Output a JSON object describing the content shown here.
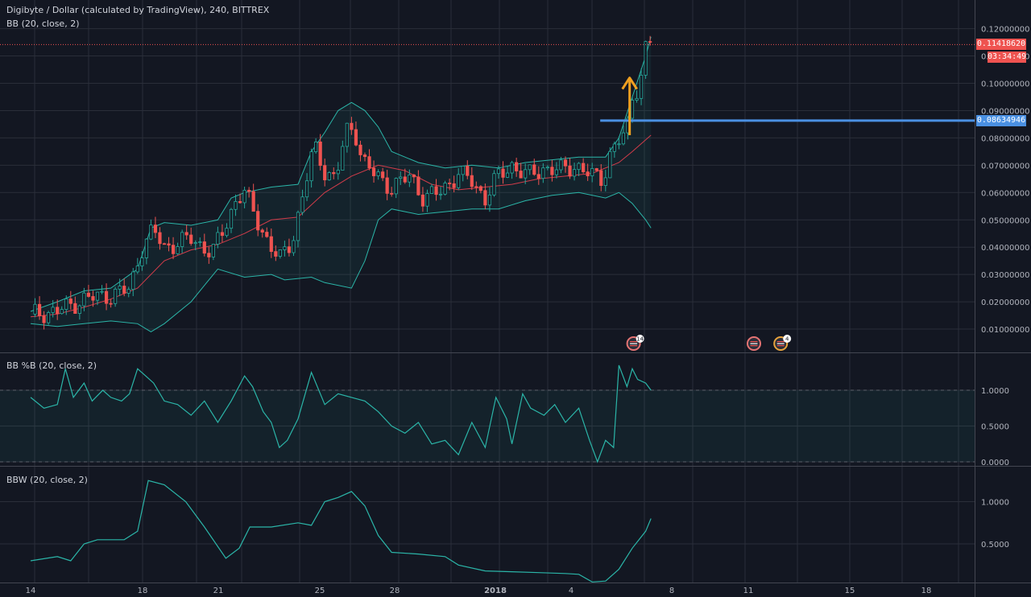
{
  "header": {
    "title": "Digibyte / Dollar (calculated by TradingView), 240, BITTREX",
    "bb_label": "BB (20, close, 2)",
    "pctb_label": "BB %B (20, close, 2)",
    "bbw_label": "BBW (20, close, 2)"
  },
  "tags": {
    "last_price": "0.11418620",
    "countdown": "03:34:49",
    "level_price": "0.08634946",
    "hidden_prefix": "0."
  },
  "events": [
    {
      "date_index": 23.0,
      "badge": "14"
    },
    {
      "date_index": 27.5,
      "badge": ""
    },
    {
      "date_index": 28.5,
      "badge": "4"
    }
  ],
  "colors": {
    "background": "#131722",
    "grid": "#2a2e39",
    "up": "#26a69a",
    "down": "#ef5350",
    "band": "#2bb5a8",
    "basis": "#d23c4a",
    "level": "#4a90e2",
    "arrow": "#f0a020",
    "price_line": "#ef5350"
  },
  "chart_data": [
    {
      "type": "candlestick",
      "title": "Digibyte / Dollar (calculated by TradingView), 240, BITTREX",
      "x_ticks": [
        "14",
        "18",
        "21",
        "25",
        "28",
        "2018",
        "4",
        "8",
        "11",
        "15",
        "18"
      ],
      "y_ticks": [
        "0.12000000",
        "0.11000000",
        "0.10000000",
        "0.09000000",
        "0.08000000",
        "0.07000000",
        "0.06000000",
        "0.05000000",
        "0.04000000",
        "0.03000000",
        "0.02000000",
        "0.01000000"
      ],
      "ylim": [
        0.002,
        0.125
      ],
      "horizontal_level": 0.08634946,
      "last_price": 0.1141862,
      "arrow": {
        "date_index": 22.4,
        "from": 0.081,
        "to": 0.102
      },
      "close_series": [
        {
          "d": 0.0,
          "v": 0.0155
        },
        {
          "d": 1.0,
          "v": 0.0165
        },
        {
          "d": 2.0,
          "v": 0.021
        },
        {
          "d": 3.0,
          "v": 0.0225
        },
        {
          "d": 3.7,
          "v": 0.0245
        },
        {
          "d": 4.2,
          "v": 0.041
        },
        {
          "d": 4.6,
          "v": 0.046
        },
        {
          "d": 5.0,
          "v": 0.04
        },
        {
          "d": 6.0,
          "v": 0.043
        },
        {
          "d": 6.8,
          "v": 0.038
        },
        {
          "d": 7.3,
          "v": 0.048
        },
        {
          "d": 7.7,
          "v": 0.058
        },
        {
          "d": 8.0,
          "v": 0.06
        },
        {
          "d": 8.6,
          "v": 0.047
        },
        {
          "d": 9.3,
          "v": 0.035
        },
        {
          "d": 9.8,
          "v": 0.043
        },
        {
          "d": 10.2,
          "v": 0.06
        },
        {
          "d": 10.6,
          "v": 0.077
        },
        {
          "d": 11.0,
          "v": 0.068
        },
        {
          "d": 11.4,
          "v": 0.065
        },
        {
          "d": 11.8,
          "v": 0.082
        },
        {
          "d": 12.1,
          "v": 0.084
        },
        {
          "d": 12.4,
          "v": 0.072
        },
        {
          "d": 12.9,
          "v": 0.066
        },
        {
          "d": 13.5,
          "v": 0.062
        },
        {
          "d": 14.2,
          "v": 0.066
        },
        {
          "d": 14.7,
          "v": 0.058
        },
        {
          "d": 15.3,
          "v": 0.06
        },
        {
          "d": 16.0,
          "v": 0.067
        },
        {
          "d": 16.5,
          "v": 0.064
        },
        {
          "d": 17.0,
          "v": 0.058
        },
        {
          "d": 17.4,
          "v": 0.065
        },
        {
          "d": 18.0,
          "v": 0.07
        },
        {
          "d": 18.6,
          "v": 0.066
        },
        {
          "d": 19.2,
          "v": 0.069
        },
        {
          "d": 19.8,
          "v": 0.068
        },
        {
          "d": 20.4,
          "v": 0.07
        },
        {
          "d": 21.0,
          "v": 0.066
        },
        {
          "d": 21.4,
          "v": 0.065
        },
        {
          "d": 21.7,
          "v": 0.075
        },
        {
          "d": 22.0,
          "v": 0.079
        },
        {
          "d": 22.3,
          "v": 0.082
        },
        {
          "d": 22.5,
          "v": 0.095
        },
        {
          "d": 22.7,
          "v": 0.099
        },
        {
          "d": 22.9,
          "v": 0.105
        },
        {
          "d": 23.05,
          "v": 0.117
        },
        {
          "d": 23.25,
          "v": 0.1142
        }
      ],
      "bb_upper": [
        {
          "d": 0.0,
          "v": 0.0165
        },
        {
          "d": 1.0,
          "v": 0.02
        },
        {
          "d": 2.0,
          "v": 0.024
        },
        {
          "d": 3.0,
          "v": 0.025
        },
        {
          "d": 4.0,
          "v": 0.032
        },
        {
          "d": 4.5,
          "v": 0.047
        },
        {
          "d": 5.0,
          "v": 0.049
        },
        {
          "d": 6.0,
          "v": 0.048
        },
        {
          "d": 7.0,
          "v": 0.05
        },
        {
          "d": 7.5,
          "v": 0.058
        },
        {
          "d": 8.0,
          "v": 0.06
        },
        {
          "d": 9.0,
          "v": 0.062
        },
        {
          "d": 10.0,
          "v": 0.063
        },
        {
          "d": 10.5,
          "v": 0.075
        },
        {
          "d": 11.0,
          "v": 0.082
        },
        {
          "d": 11.5,
          "v": 0.09
        },
        {
          "d": 12.0,
          "v": 0.093
        },
        {
          "d": 12.5,
          "v": 0.09
        },
        {
          "d": 13.0,
          "v": 0.084
        },
        {
          "d": 13.5,
          "v": 0.075
        },
        {
          "d": 14.5,
          "v": 0.071
        },
        {
          "d": 15.5,
          "v": 0.069
        },
        {
          "d": 16.5,
          "v": 0.07
        },
        {
          "d": 17.5,
          "v": 0.069
        },
        {
          "d": 18.5,
          "v": 0.071
        },
        {
          "d": 19.5,
          "v": 0.072
        },
        {
          "d": 20.5,
          "v": 0.073
        },
        {
          "d": 21.5,
          "v": 0.073
        },
        {
          "d": 22.0,
          "v": 0.08
        },
        {
          "d": 22.5,
          "v": 0.095
        },
        {
          "d": 23.0,
          "v": 0.11
        },
        {
          "d": 23.2,
          "v": 0.117
        }
      ],
      "bb_basis": [
        {
          "d": 0.0,
          "v": 0.0145
        },
        {
          "d": 1.0,
          "v": 0.0155
        },
        {
          "d": 2.0,
          "v": 0.018
        },
        {
          "d": 3.0,
          "v": 0.021
        },
        {
          "d": 4.0,
          "v": 0.025
        },
        {
          "d": 5.0,
          "v": 0.035
        },
        {
          "d": 6.0,
          "v": 0.039
        },
        {
          "d": 7.0,
          "v": 0.041
        },
        {
          "d": 8.0,
          "v": 0.045
        },
        {
          "d": 9.0,
          "v": 0.05
        },
        {
          "d": 10.0,
          "v": 0.051
        },
        {
          "d": 11.0,
          "v": 0.06
        },
        {
          "d": 12.0,
          "v": 0.066
        },
        {
          "d": 13.0,
          "v": 0.07
        },
        {
          "d": 14.0,
          "v": 0.068
        },
        {
          "d": 15.0,
          "v": 0.063
        },
        {
          "d": 16.0,
          "v": 0.061
        },
        {
          "d": 17.0,
          "v": 0.062
        },
        {
          "d": 18.0,
          "v": 0.063
        },
        {
          "d": 19.0,
          "v": 0.065
        },
        {
          "d": 20.0,
          "v": 0.066
        },
        {
          "d": 21.0,
          "v": 0.067
        },
        {
          "d": 22.0,
          "v": 0.071
        },
        {
          "d": 22.5,
          "v": 0.075
        },
        {
          "d": 23.2,
          "v": 0.081
        }
      ],
      "bb_lower": [
        {
          "d": 0.0,
          "v": 0.012
        },
        {
          "d": 1.0,
          "v": 0.011
        },
        {
          "d": 2.0,
          "v": 0.012
        },
        {
          "d": 3.0,
          "v": 0.013
        },
        {
          "d": 4.0,
          "v": 0.012
        },
        {
          "d": 4.5,
          "v": 0.009
        },
        {
          "d": 5.0,
          "v": 0.012
        },
        {
          "d": 6.0,
          "v": 0.02
        },
        {
          "d": 6.5,
          "v": 0.026
        },
        {
          "d": 7.0,
          "v": 0.032
        },
        {
          "d": 8.0,
          "v": 0.029
        },
        {
          "d": 9.0,
          "v": 0.03
        },
        {
          "d": 9.5,
          "v": 0.028
        },
        {
          "d": 10.5,
          "v": 0.029
        },
        {
          "d": 11.0,
          "v": 0.027
        },
        {
          "d": 12.0,
          "v": 0.025
        },
        {
          "d": 12.5,
          "v": 0.035
        },
        {
          "d": 13.0,
          "v": 0.05
        },
        {
          "d": 13.5,
          "v": 0.054
        },
        {
          "d": 14.5,
          "v": 0.052
        },
        {
          "d": 15.5,
          "v": 0.053
        },
        {
          "d": 16.5,
          "v": 0.054
        },
        {
          "d": 17.5,
          "v": 0.054
        },
        {
          "d": 18.5,
          "v": 0.057
        },
        {
          "d": 19.5,
          "v": 0.059
        },
        {
          "d": 20.5,
          "v": 0.06
        },
        {
          "d": 21.5,
          "v": 0.058
        },
        {
          "d": 22.0,
          "v": 0.06
        },
        {
          "d": 22.5,
          "v": 0.056
        },
        {
          "d": 23.0,
          "v": 0.05
        },
        {
          "d": 23.2,
          "v": 0.047
        }
      ]
    },
    {
      "type": "line",
      "title": "BB %B (20, close, 2)",
      "y_ticks": [
        "1.0000",
        "0.5000",
        "0.0000"
      ],
      "ylim": [
        -0.05,
        1.55
      ],
      "reference_lines": [
        1.0,
        0.0
      ],
      "series": [
        {
          "d": 0.0,
          "v": 0.9
        },
        {
          "d": 0.5,
          "v": 0.75
        },
        {
          "d": 1.0,
          "v": 0.8
        },
        {
          "d": 1.3,
          "v": 1.3
        },
        {
          "d": 1.6,
          "v": 0.9
        },
        {
          "d": 2.0,
          "v": 1.1
        },
        {
          "d": 2.3,
          "v": 0.85
        },
        {
          "d": 2.7,
          "v": 1.0
        },
        {
          "d": 3.0,
          "v": 0.9
        },
        {
          "d": 3.4,
          "v": 0.85
        },
        {
          "d": 3.7,
          "v": 0.95
        },
        {
          "d": 4.0,
          "v": 1.3
        },
        {
          "d": 4.3,
          "v": 1.2
        },
        {
          "d": 4.6,
          "v": 1.1
        },
        {
          "d": 5.0,
          "v": 0.85
        },
        {
          "d": 5.5,
          "v": 0.8
        },
        {
          "d": 6.0,
          "v": 0.65
        },
        {
          "d": 6.5,
          "v": 0.85
        },
        {
          "d": 7.0,
          "v": 0.55
        },
        {
          "d": 7.5,
          "v": 0.85
        },
        {
          "d": 8.0,
          "v": 1.2
        },
        {
          "d": 8.3,
          "v": 1.05
        },
        {
          "d": 8.7,
          "v": 0.7
        },
        {
          "d": 9.0,
          "v": 0.55
        },
        {
          "d": 9.3,
          "v": 0.2
        },
        {
          "d": 9.6,
          "v": 0.3
        },
        {
          "d": 10.0,
          "v": 0.6
        },
        {
          "d": 10.5,
          "v": 1.25
        },
        {
          "d": 11.0,
          "v": 0.8
        },
        {
          "d": 11.5,
          "v": 0.95
        },
        {
          "d": 12.0,
          "v": 0.9
        },
        {
          "d": 12.5,
          "v": 0.85
        },
        {
          "d": 13.0,
          "v": 0.7
        },
        {
          "d": 13.5,
          "v": 0.5
        },
        {
          "d": 14.0,
          "v": 0.4
        },
        {
          "d": 14.5,
          "v": 0.55
        },
        {
          "d": 15.0,
          "v": 0.25
        },
        {
          "d": 15.5,
          "v": 0.3
        },
        {
          "d": 16.0,
          "v": 0.1
        },
        {
          "d": 16.5,
          "v": 0.55
        },
        {
          "d": 17.0,
          "v": 0.2
        },
        {
          "d": 17.4,
          "v": 0.9
        },
        {
          "d": 17.8,
          "v": 0.6
        },
        {
          "d": 18.0,
          "v": 0.25
        },
        {
          "d": 18.4,
          "v": 0.95
        },
        {
          "d": 18.7,
          "v": 0.75
        },
        {
          "d": 19.2,
          "v": 0.65
        },
        {
          "d": 19.6,
          "v": 0.8
        },
        {
          "d": 20.0,
          "v": 0.55
        },
        {
          "d": 20.5,
          "v": 0.75
        },
        {
          "d": 20.9,
          "v": 0.3
        },
        {
          "d": 21.2,
          "v": 0.0
        },
        {
          "d": 21.5,
          "v": 0.3
        },
        {
          "d": 21.8,
          "v": 0.2
        },
        {
          "d": 22.0,
          "v": 1.35
        },
        {
          "d": 22.3,
          "v": 1.05
        },
        {
          "d": 22.5,
          "v": 1.3
        },
        {
          "d": 22.7,
          "v": 1.15
        },
        {
          "d": 23.0,
          "v": 1.1
        },
        {
          "d": 23.2,
          "v": 1.0
        }
      ]
    },
    {
      "type": "line",
      "title": "BBW (20, close, 2)",
      "y_ticks": [
        "1.0000",
        "0.5000"
      ],
      "ylim": [
        0.0,
        1.3
      ],
      "series": [
        {
          "d": 0.0,
          "v": 0.3
        },
        {
          "d": 1.0,
          "v": 0.35
        },
        {
          "d": 1.5,
          "v": 0.3
        },
        {
          "d": 2.0,
          "v": 0.5
        },
        {
          "d": 2.5,
          "v": 0.55
        },
        {
          "d": 3.5,
          "v": 0.55
        },
        {
          "d": 4.0,
          "v": 0.65
        },
        {
          "d": 4.4,
          "v": 1.25
        },
        {
          "d": 5.0,
          "v": 1.2
        },
        {
          "d": 5.8,
          "v": 1.0
        },
        {
          "d": 6.5,
          "v": 0.7
        },
        {
          "d": 7.3,
          "v": 0.33
        },
        {
          "d": 7.8,
          "v": 0.45
        },
        {
          "d": 8.2,
          "v": 0.7
        },
        {
          "d": 9.0,
          "v": 0.7
        },
        {
          "d": 10.0,
          "v": 0.75
        },
        {
          "d": 10.5,
          "v": 0.72
        },
        {
          "d": 11.0,
          "v": 1.0
        },
        {
          "d": 11.5,
          "v": 1.05
        },
        {
          "d": 12.0,
          "v": 1.12
        },
        {
          "d": 12.5,
          "v": 0.95
        },
        {
          "d": 13.0,
          "v": 0.6
        },
        {
          "d": 13.5,
          "v": 0.4
        },
        {
          "d": 14.5,
          "v": 0.38
        },
        {
          "d": 15.5,
          "v": 0.35
        },
        {
          "d": 16.0,
          "v": 0.25
        },
        {
          "d": 17.0,
          "v": 0.18
        },
        {
          "d": 18.0,
          "v": 0.17
        },
        {
          "d": 19.0,
          "v": 0.16
        },
        {
          "d": 20.0,
          "v": 0.15
        },
        {
          "d": 20.5,
          "v": 0.14
        },
        {
          "d": 21.0,
          "v": 0.05
        },
        {
          "d": 21.5,
          "v": 0.06
        },
        {
          "d": 22.0,
          "v": 0.2
        },
        {
          "d": 22.5,
          "v": 0.45
        },
        {
          "d": 23.0,
          "v": 0.65
        },
        {
          "d": 23.2,
          "v": 0.8
        }
      ]
    }
  ]
}
